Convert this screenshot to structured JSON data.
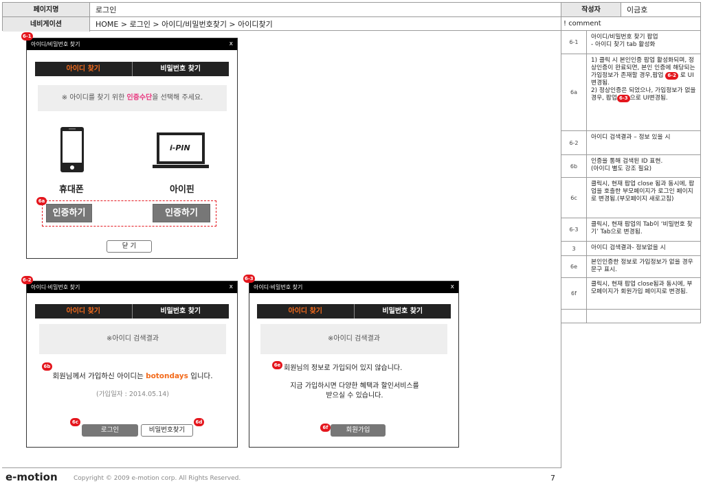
{
  "header": {
    "page_name_label": "페이지명",
    "page_name_value": "로그인",
    "nav_label": "네비게이션",
    "nav_value": "HOME > 로그인 > 아이디/비밀번호찾기 > 아이디찾기",
    "author_label": "작성자",
    "author_value": "이금호"
  },
  "popup1": {
    "badge": "6-1",
    "title": "아이디/비밀번호 찾기",
    "close": "x",
    "tab_id": "아이디 찾기",
    "tab_pw": "비밀번호 찾기",
    "notice_pre": "※ 아이디를 찾기 위한 ",
    "notice_hl": "인증수단",
    "notice_post": "을 선택해 주세요.",
    "ipin_text": "i-PIN",
    "phone_label": "휴대폰",
    "ipin_label": "아이핀",
    "badge_a": "6a",
    "btn_phone": "인증하기",
    "btn_ipin": "인증하기",
    "btn_close": "닫 기"
  },
  "popup2": {
    "badge": "6-2",
    "title": "아이디·비밀번호 찾기",
    "close": "x",
    "tab_id": "아이디 찾기",
    "tab_pw": "비밀번호 찾기",
    "result_title": "※아이디 검색결과",
    "badge_b": "6b",
    "msg_pre": "회원님께서 가입하신 아이디는 ",
    "msg_id": "botondays",
    "msg_post": " 입니다.",
    "join_date": "(가입일자 : 2014.05.14)",
    "badge_c": "6c",
    "badge_d": "6d",
    "btn_login": "로그인",
    "btn_findpw": "비밀번호찾기"
  },
  "popup3": {
    "badge": "6-3",
    "title": "아이디·비밀번호 찾기",
    "close": "x",
    "tab_id": "아이디 찾기",
    "tab_pw": "비밀번호 찾기",
    "result_title": "※아이디 검색결과",
    "badge_e": "6e",
    "msg1": "회원님의 정보로 가입되어 있지 않습니다.",
    "msg2": "지금 가입하시면 다양한 혜택과 할인서비스를",
    "msg3": "받으실 수 있습니다.",
    "badge_f": "6f",
    "btn_join": "회원가입"
  },
  "comments": {
    "header": "! comment",
    "rows": [
      {
        "id": "6-1",
        "text": "아이디/비밀번호 찾기 팝업\n- 아이디 찾기 tab 활성화"
      },
      {
        "id": "6a",
        "text_a": "1) 클릭 시 본인인증 팝업 활성화되며, 정상인증이 완료되면, 본인 인증에 해당되는 가입정보가 존재할 경우,팝업 ",
        "badge1": "6-2",
        "text_b": " 로 UI변경됨.\n2) 정상인증은 되었으나, 가입정보가 없을 경우, 팝업",
        "badge2": "6-3",
        "text_c": "으로 UI변경됨."
      },
      {
        "id": "6-2",
        "text": "아이디 검색결과 – 정보 있을 시"
      },
      {
        "id": "6b",
        "text": "인증을 통해 검색된 ID 표현.\n(아이디 별도 강조 필요)"
      },
      {
        "id": "6c",
        "text": "클릭시, 현재 팝업 close 됨과 동시에,   팝업을 호출한 부모페이지가 로그인 페이지로 변경됨.(부모페이지 새로고침)"
      },
      {
        "id": "6-3",
        "text": "클릭시, 현재 팝업의 Tab이 ‘비밀번호  찾기’ Tab으로 변경됨."
      },
      {
        "id": "3",
        "text": "아이디 검색결과- 정보없을 시"
      },
      {
        "id": "6e",
        "text": "본인인증한 정보로 가입정보가 없을 경우 문구 표시."
      },
      {
        "id": "6f",
        "text": "클릭시, 현재 팝업 close됨과 동시에, 부모페이지가 회원가입 페이지로 변경됨."
      },
      {
        "id": "",
        "text": ""
      }
    ]
  },
  "footer": {
    "logo": "e-motion",
    "copyright": "Copyright © 2009 e-motion corp. All Rights Reserved.",
    "page_number": "7"
  }
}
